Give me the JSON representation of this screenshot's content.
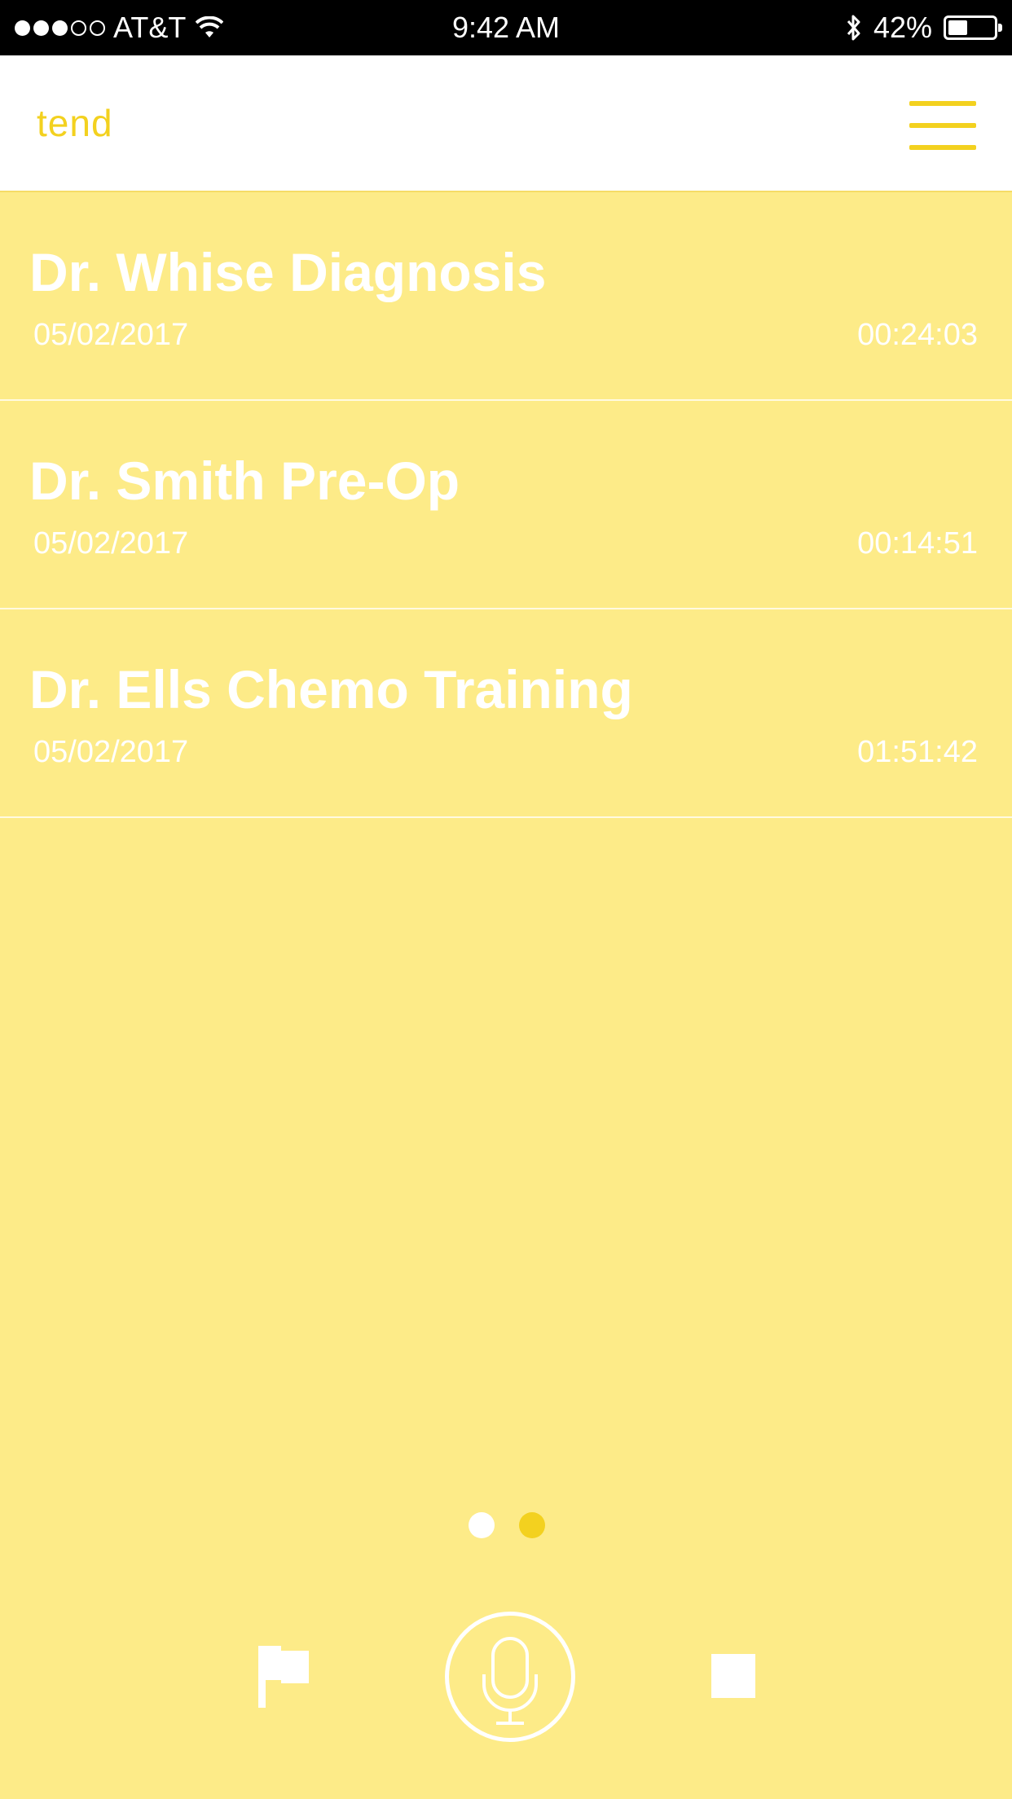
{
  "status_bar": {
    "carrier": "AT&T",
    "time": "9:42 AM",
    "battery": "42%",
    "battery_level": 0.42,
    "signal_bars_full": 3,
    "signal_bars_total": 5
  },
  "header": {
    "logo": "tend",
    "menu_icon": "hamburger-menu-icon"
  },
  "recordings": [
    {
      "title": "Dr. Whise Diagnosis",
      "date": "05/02/2017",
      "duration": "00:24:03"
    },
    {
      "title": "Dr. Smith Pre-Op",
      "date": "05/02/2017",
      "duration": "00:14:51"
    },
    {
      "title": "Dr. Ells Chemo Training",
      "date": "05/02/2017",
      "duration": "01:51:42"
    }
  ],
  "pager": {
    "pages": 2,
    "current": 2
  },
  "controls": {
    "flag_icon": "flag-icon",
    "mic_icon": "microphone-icon",
    "stop_icon": "stop-icon"
  },
  "colors": {
    "background": "#FDEB88",
    "accent": "#F3D11F",
    "header_bg": "#FFFFFF",
    "status_bar_bg": "#000000"
  }
}
